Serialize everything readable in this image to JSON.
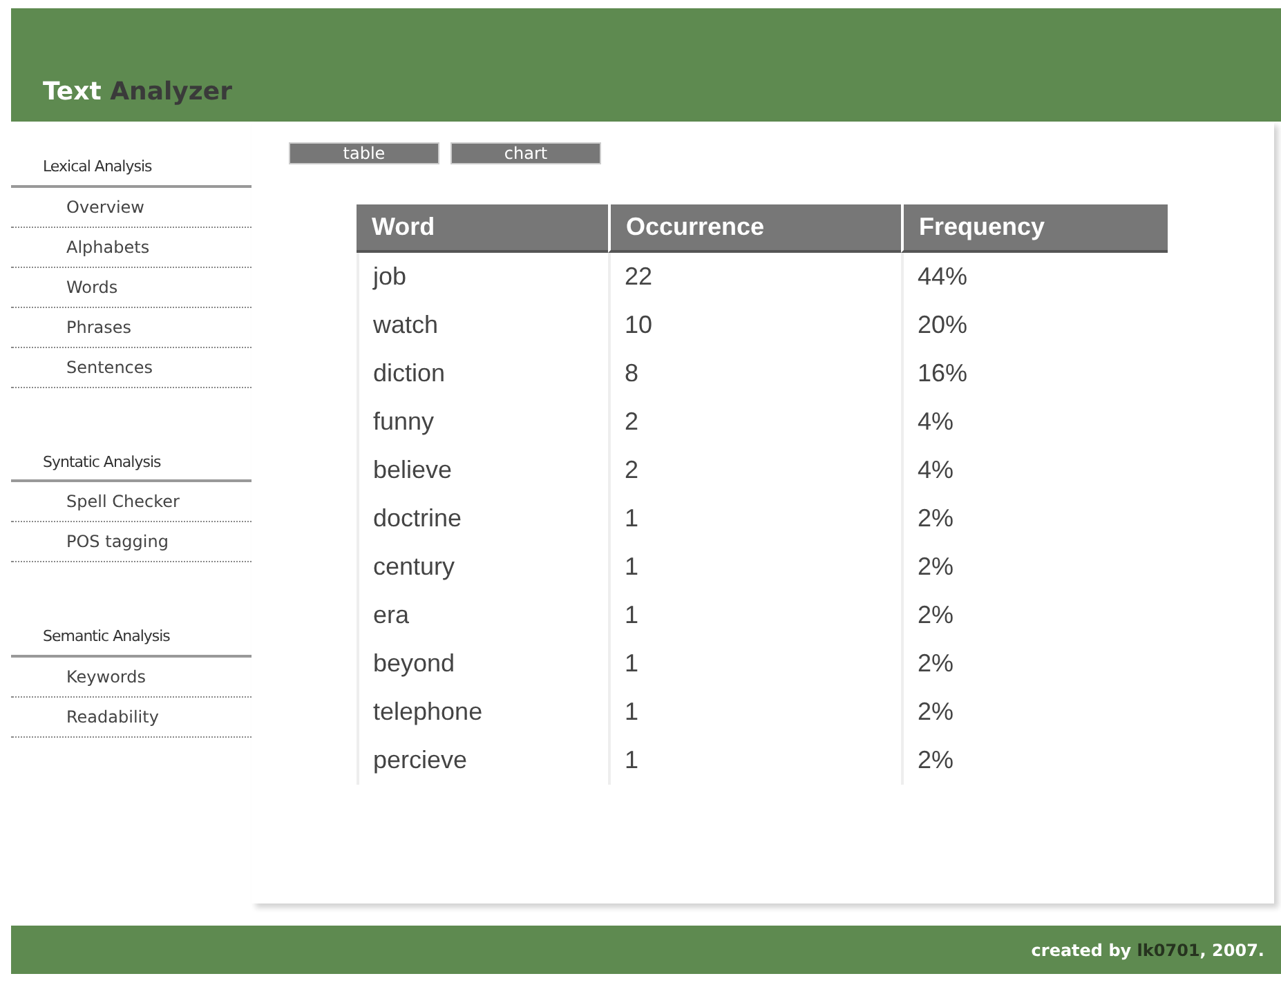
{
  "header": {
    "title_first": "Text",
    "title_second": "Analyzer"
  },
  "sidebar": {
    "sections": [
      {
        "title": "Lexical Analysis",
        "items": [
          "Overview",
          "Alphabets",
          "Words",
          "Phrases",
          "Sentences"
        ]
      },
      {
        "title": "Syntatic Analysis",
        "items": [
          "Spell Checker",
          "POS tagging"
        ]
      },
      {
        "title": "Semantic Analysis",
        "items": [
          "Keywords",
          "Readability"
        ]
      }
    ]
  },
  "view_buttons": [
    "table",
    "chart"
  ],
  "table": {
    "columns": [
      "Word",
      "Occurrence",
      "Frequency"
    ],
    "rows": [
      [
        "job",
        "22",
        "44%"
      ],
      [
        "watch",
        "10",
        "20%"
      ],
      [
        "diction",
        "8",
        "16%"
      ],
      [
        "funny",
        "2",
        "4%"
      ],
      [
        "believe",
        "2",
        "4%"
      ],
      [
        "doctrine",
        "1",
        "2%"
      ],
      [
        "century",
        "1",
        "2%"
      ],
      [
        "era",
        "1",
        "2%"
      ],
      [
        "beyond",
        "1",
        "2%"
      ],
      [
        "telephone",
        "1",
        "2%"
      ],
      [
        "percieve",
        "1",
        "2%"
      ]
    ]
  },
  "footer": {
    "prefix": "created by",
    "author": "lk0701",
    "suffix": ", 2007."
  }
}
